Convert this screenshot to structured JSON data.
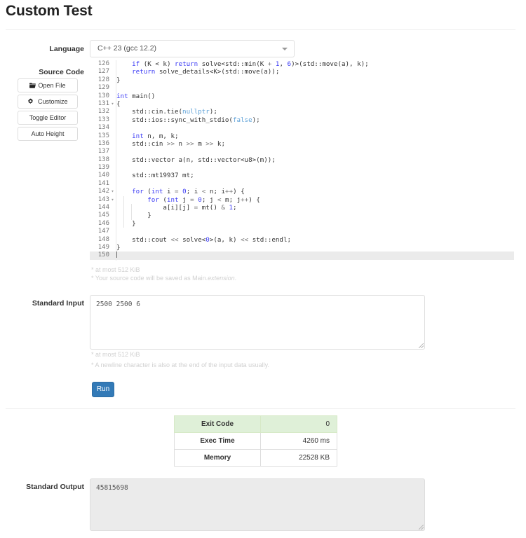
{
  "header": {
    "title": "Custom Test"
  },
  "form": {
    "language_label": "Language",
    "language_value": "C++ 23 (gcc 12.2)",
    "source_code_label": "Source Code",
    "standard_input_label": "Standard Input",
    "standard_output_label": "Standard Output"
  },
  "side_buttons": [
    {
      "label": "Open File",
      "icon": "folder-open-icon"
    },
    {
      "label": "Customize",
      "icon": "gear-icon"
    },
    {
      "label": "Toggle Editor",
      "icon": ""
    },
    {
      "label": "Auto Height",
      "icon": ""
    }
  ],
  "editor": {
    "first_line": 126,
    "active_line": 150,
    "lines": [
      {
        "no": 126,
        "fold": "",
        "html": "    <span class=\"k\">if</span> (K &lt; k) <span class=\"k\">return</span> solve&lt;std::min(K <span class=\"op\">+</span> <span class=\"n\">1</span>, <span class=\"n\">6</span>)&gt;(std::move(a), k);"
      },
      {
        "no": 127,
        "fold": "",
        "html": "    <span class=\"k\">return</span> solve_details&lt;K&gt;(std::move(a));"
      },
      {
        "no": 128,
        "fold": "",
        "html": "}"
      },
      {
        "no": 129,
        "fold": "",
        "html": ""
      },
      {
        "no": 130,
        "fold": "",
        "html": "<span class=\"k\">int</span> main()"
      },
      {
        "no": 131,
        "fold": "-",
        "html": "{"
      },
      {
        "no": 132,
        "fold": "",
        "html": "    std::cin.tie(<span class=\"c\">nullptr</span>);"
      },
      {
        "no": 133,
        "fold": "",
        "html": "    std::ios::sync_with_stdio(<span class=\"c\">false</span>);"
      },
      {
        "no": 134,
        "fold": "",
        "html": ""
      },
      {
        "no": 135,
        "fold": "",
        "html": "    <span class=\"k\">int</span> n, m, k;"
      },
      {
        "no": 136,
        "fold": "",
        "html": "    std::cin <span class=\"op\">&gt;&gt;</span> n <span class=\"op\">&gt;&gt;</span> m <span class=\"op\">&gt;&gt;</span> k;"
      },
      {
        "no": 137,
        "fold": "",
        "html": ""
      },
      {
        "no": 138,
        "fold": "",
        "html": "    std::vector a(n, std::vector&lt;u8&gt;(m));"
      },
      {
        "no": 139,
        "fold": "",
        "html": ""
      },
      {
        "no": 140,
        "fold": "",
        "html": "    std::mt19937 mt;"
      },
      {
        "no": 141,
        "fold": "",
        "html": ""
      },
      {
        "no": 142,
        "fold": "-",
        "html": "    <span class=\"k\">for</span> (<span class=\"k\">int</span> i <span class=\"op\">=</span> <span class=\"n\">0</span>; i <span class=\"op\">&lt;</span> n; i<span class=\"op\">++</span>) {"
      },
      {
        "no": 143,
        "fold": "-",
        "html": "        <span class=\"k\">for</span> (<span class=\"k\">int</span> j <span class=\"op\">=</span> <span class=\"n\">0</span>; j <span class=\"op\">&lt;</span> m; j<span class=\"op\">++</span>) {"
      },
      {
        "no": 144,
        "fold": "",
        "html": "            a[i][j] <span class=\"op\">=</span> mt() <span class=\"op\">&amp;</span> <span class=\"n\">1</span>;"
      },
      {
        "no": 145,
        "fold": "",
        "html": "        }"
      },
      {
        "no": 146,
        "fold": "",
        "html": "    }"
      },
      {
        "no": 147,
        "fold": "",
        "html": ""
      },
      {
        "no": 148,
        "fold": "",
        "html": "    std::cout <span class=\"op\">&lt;&lt;</span> solve&lt;<span class=\"n\">0</span>&gt;(a, k) <span class=\"op\">&lt;&lt;</span> std::endl;"
      },
      {
        "no": 149,
        "fold": "",
        "html": "}"
      },
      {
        "no": 150,
        "fold": "",
        "html": "<span class=\"caret-bar\"></span>"
      }
    ]
  },
  "notes": {
    "source_size": "* at most 512 KiB",
    "source_filename_prefix": "* Your source code will be saved as Main.",
    "source_filename_italic": "extension",
    "source_filename_suffix": ".",
    "input_size": "* at most 512 KiB",
    "input_newline": "* A newline character is also at the end of the input data usually."
  },
  "inputs": {
    "standard_input_value": "2500 2500 6",
    "standard_output_value": "45815698"
  },
  "run": {
    "label": "Run"
  },
  "results": {
    "rows": [
      {
        "key": "Exit Code",
        "value": "0",
        "highlight": true
      },
      {
        "key": "Exec Time",
        "value": "4260 ms",
        "highlight": false
      },
      {
        "key": "Memory",
        "value": "22528 KB",
        "highlight": false
      }
    ]
  },
  "colors": {
    "accent": "#337ab7",
    "success_bg": "#dff0d8",
    "keyword": "#3b3bf5",
    "constant": "#5fa2d8",
    "divider": "#eeeeee"
  }
}
